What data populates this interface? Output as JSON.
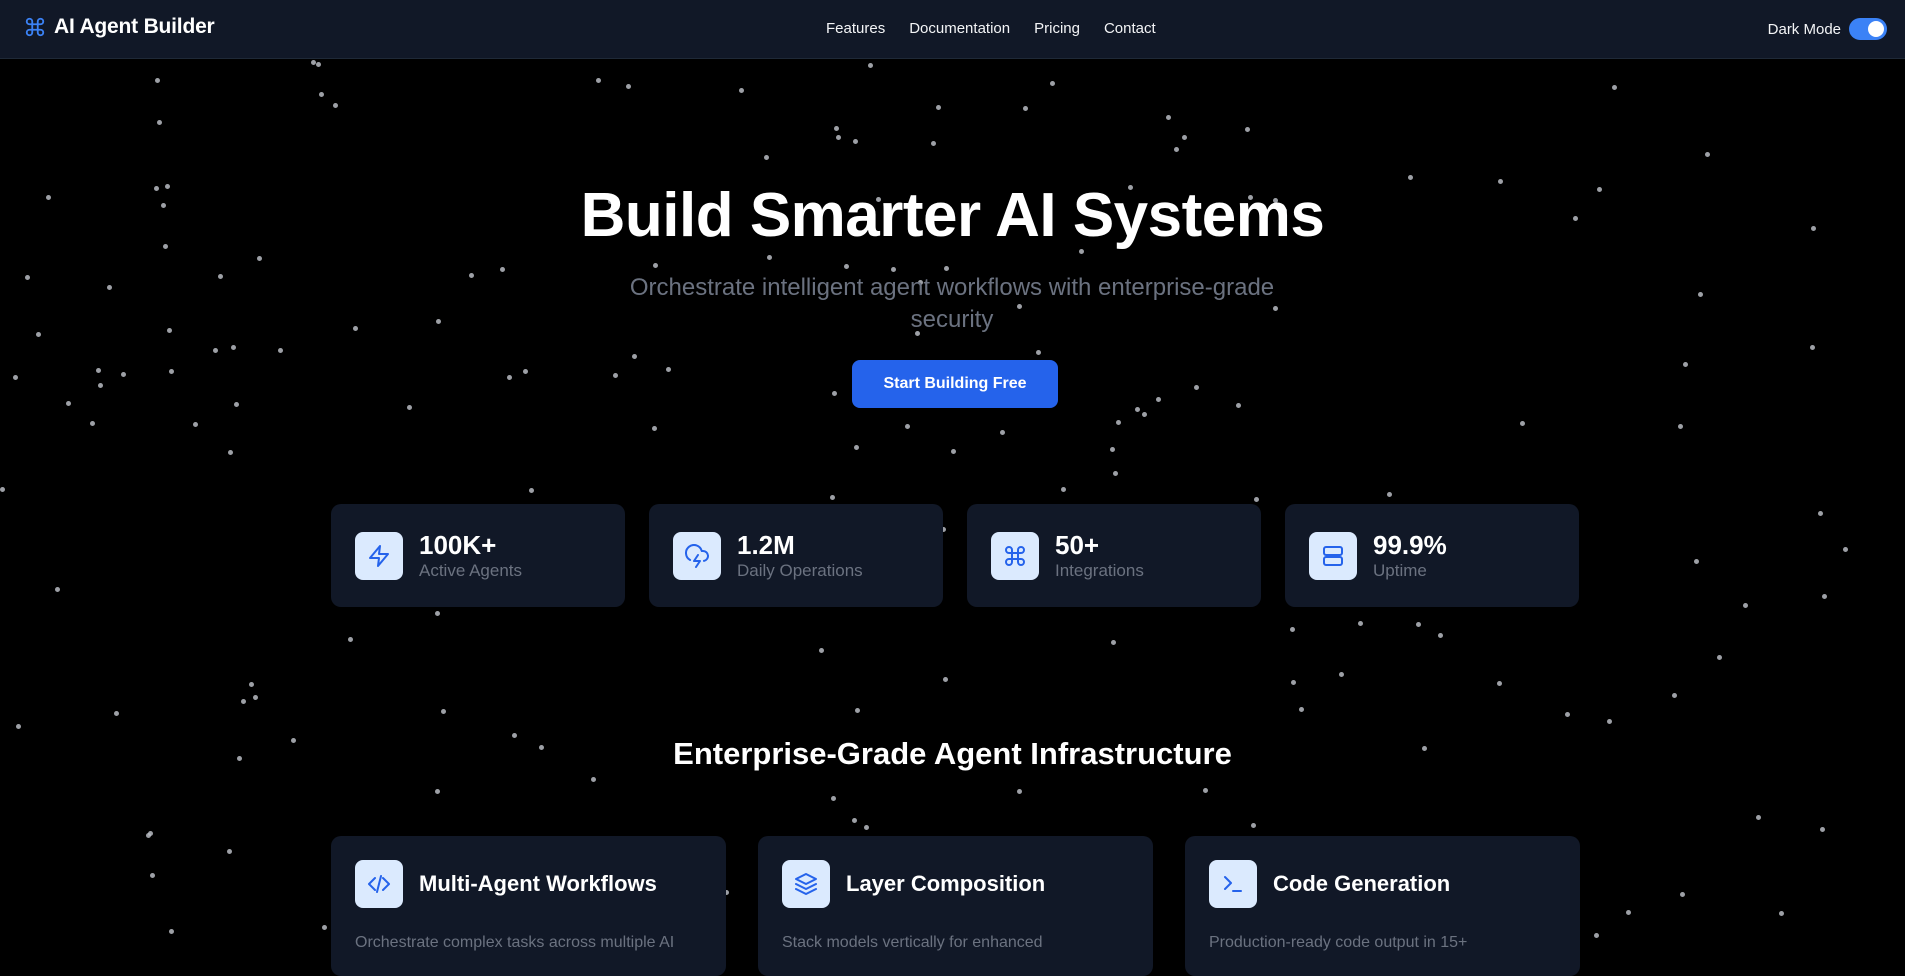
{
  "nav": {
    "brand": "AI Agent Builder",
    "brand_icon": "command-icon",
    "links": [
      "Features",
      "Documentation",
      "Pricing",
      "Contact"
    ],
    "dark_mode_label": "Dark Mode",
    "dark_mode_on": true
  },
  "hero": {
    "title": "Build Smarter AI Systems",
    "subtitle": "Orchestrate intelligent agent workflows with enterprise-grade security",
    "cta": "Start Building Free"
  },
  "stats": [
    {
      "icon": "zap-icon",
      "value": "100K+",
      "label": "Active Agents"
    },
    {
      "icon": "cloud-lightning-icon",
      "value": "1.2M",
      "label": "Daily Operations"
    },
    {
      "icon": "command-icon",
      "value": "50+",
      "label": "Integrations"
    },
    {
      "icon": "server-icon",
      "value": "99.9%",
      "label": "Uptime"
    }
  ],
  "section": {
    "title": "Enterprise-Grade Agent Infrastructure"
  },
  "features": [
    {
      "icon": "code-icon",
      "title": "Multi-Agent Workflows",
      "desc": "Orchestrate complex tasks across multiple AI"
    },
    {
      "icon": "layers-icon",
      "title": "Layer Composition",
      "desc": "Stack models vertically for enhanced"
    },
    {
      "icon": "terminal-icon",
      "title": "Code Generation",
      "desc": "Production-ready code output in 15+"
    }
  ],
  "colors": {
    "background": "#000000",
    "nav_bg": "#111827",
    "card_bg": "#111827",
    "accent": "#2563eb",
    "icon_bg": "#dbeafe",
    "muted_text": "#6b7280"
  }
}
